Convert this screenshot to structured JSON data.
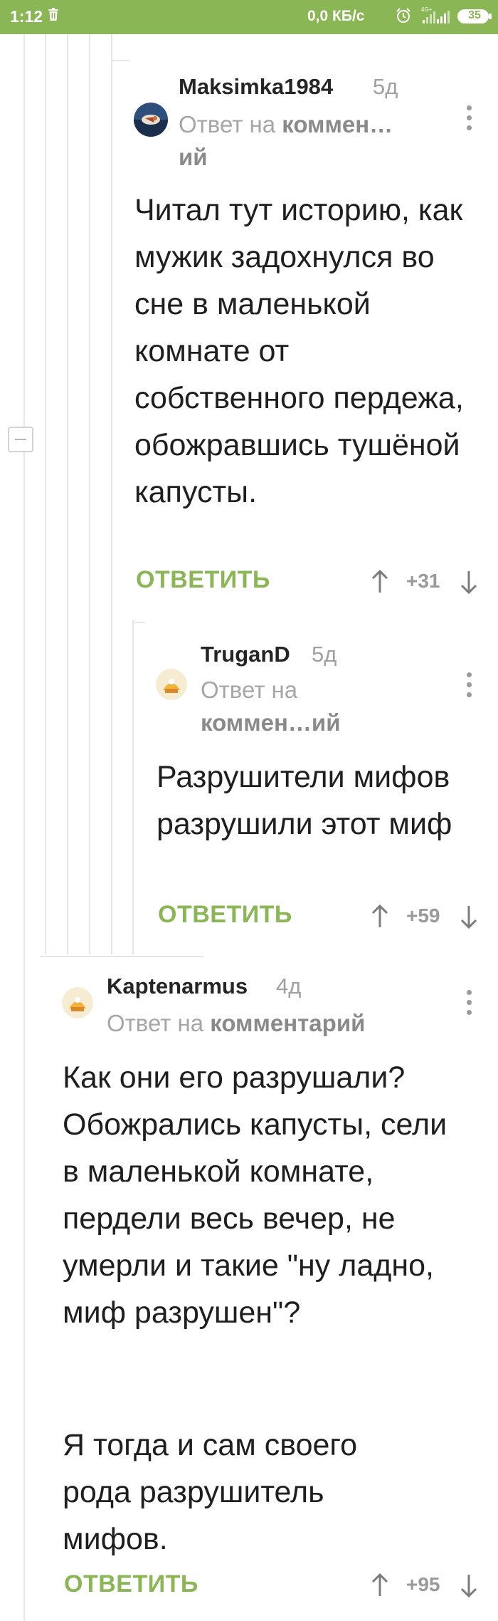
{
  "status_bar": {
    "time": "1:12",
    "network_speed": "0,0 КБ/с",
    "network_type": "4G+",
    "battery": "35"
  },
  "comments": [
    {
      "username": "Maksimka1984",
      "age": "5д",
      "reply_prefix": "Ответ на",
      "reply_link": "коммен…ий",
      "text": "Читал тут историю, как мужик задохнулся во сне в маленькой комнате от собственного пердежа, обожравшись тушёной капусты.",
      "reply_label": "ОТВЕТИТЬ",
      "rating": "+31"
    },
    {
      "username": "TruganD",
      "age": "5д",
      "reply_prefix": "Ответ на",
      "reply_link": "коммен…ий",
      "text": "Разрушители мифов разрушили этот миф",
      "reply_label": "ОТВЕТИТЬ",
      "rating": "+59"
    },
    {
      "username": "Kaptenarmus",
      "age": "4д",
      "reply_prefix": "Ответ на",
      "reply_link": "комментарий",
      "text_paragraph_1": "Как они его разрушали? Обожрались капусты, сели в маленькой комнате, пердели весь вечер, не умерли и такие \"ну ладно, миф разрушен\"?",
      "text_paragraph_2": "Я тогда и сам своего рода разрушитель мифов.",
      "reply_label": "ОТВЕТИТЬ",
      "rating": "+95"
    }
  ]
}
